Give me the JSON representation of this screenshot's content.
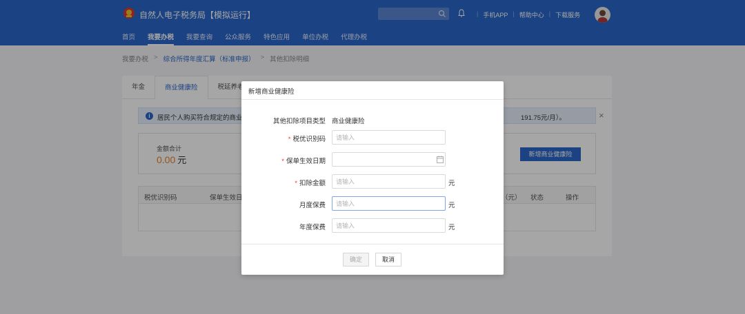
{
  "header": {
    "title": "自然人电子税务局【模拟运行】",
    "search_placeholder": "",
    "links": [
      "手机APP",
      "帮助中心",
      "下载服务"
    ],
    "nav": [
      "首页",
      "我要办税",
      "我要查询",
      "公众服务",
      "特色应用",
      "单位办税",
      "代理办税"
    ],
    "nav_active": 1
  },
  "breadcrumb": {
    "items": [
      "我要办税",
      "综合所得年度汇算（标准申报）",
      "其他扣除明细"
    ]
  },
  "tabs": [
    "年金",
    "商业健康险",
    "税延养老保险"
  ],
  "notice": {
    "text": "居民个人购买符合规定的商业",
    "tail": "191.75元/月）。"
  },
  "summary": {
    "label": "金额合计",
    "value": "0.00",
    "unit": "元",
    "add_button": "新增商业健康险"
  },
  "table": {
    "headers": [
      "税优识别码",
      "保单生效日",
      "（元）",
      "状态",
      "操作"
    ]
  },
  "modal": {
    "title": "新增商业健康险",
    "fields": {
      "type_label": "其他扣除项目类型",
      "type_value": "商业健康险",
      "code_label": "税优识别码",
      "code_placeholder": "请输入",
      "date_label": "保单生效日期",
      "amount_label": "扣除金额",
      "amount_placeholder": "请输入",
      "monthly_label": "月度保费",
      "monthly_placeholder": "请输入",
      "annual_label": "年度保费",
      "annual_placeholder": "请输入",
      "unit": "元"
    },
    "ok_button": "确定",
    "cancel_button": "取消"
  },
  "colors": {
    "brand": "#2a66c9",
    "amount": "#e8802a",
    "required": "#e83a3a"
  },
  "icons": [
    "logo-emblem-icon",
    "search-icon",
    "bell-icon",
    "info-icon",
    "close-icon",
    "calendar-icon",
    "chevron-right-icon"
  ]
}
